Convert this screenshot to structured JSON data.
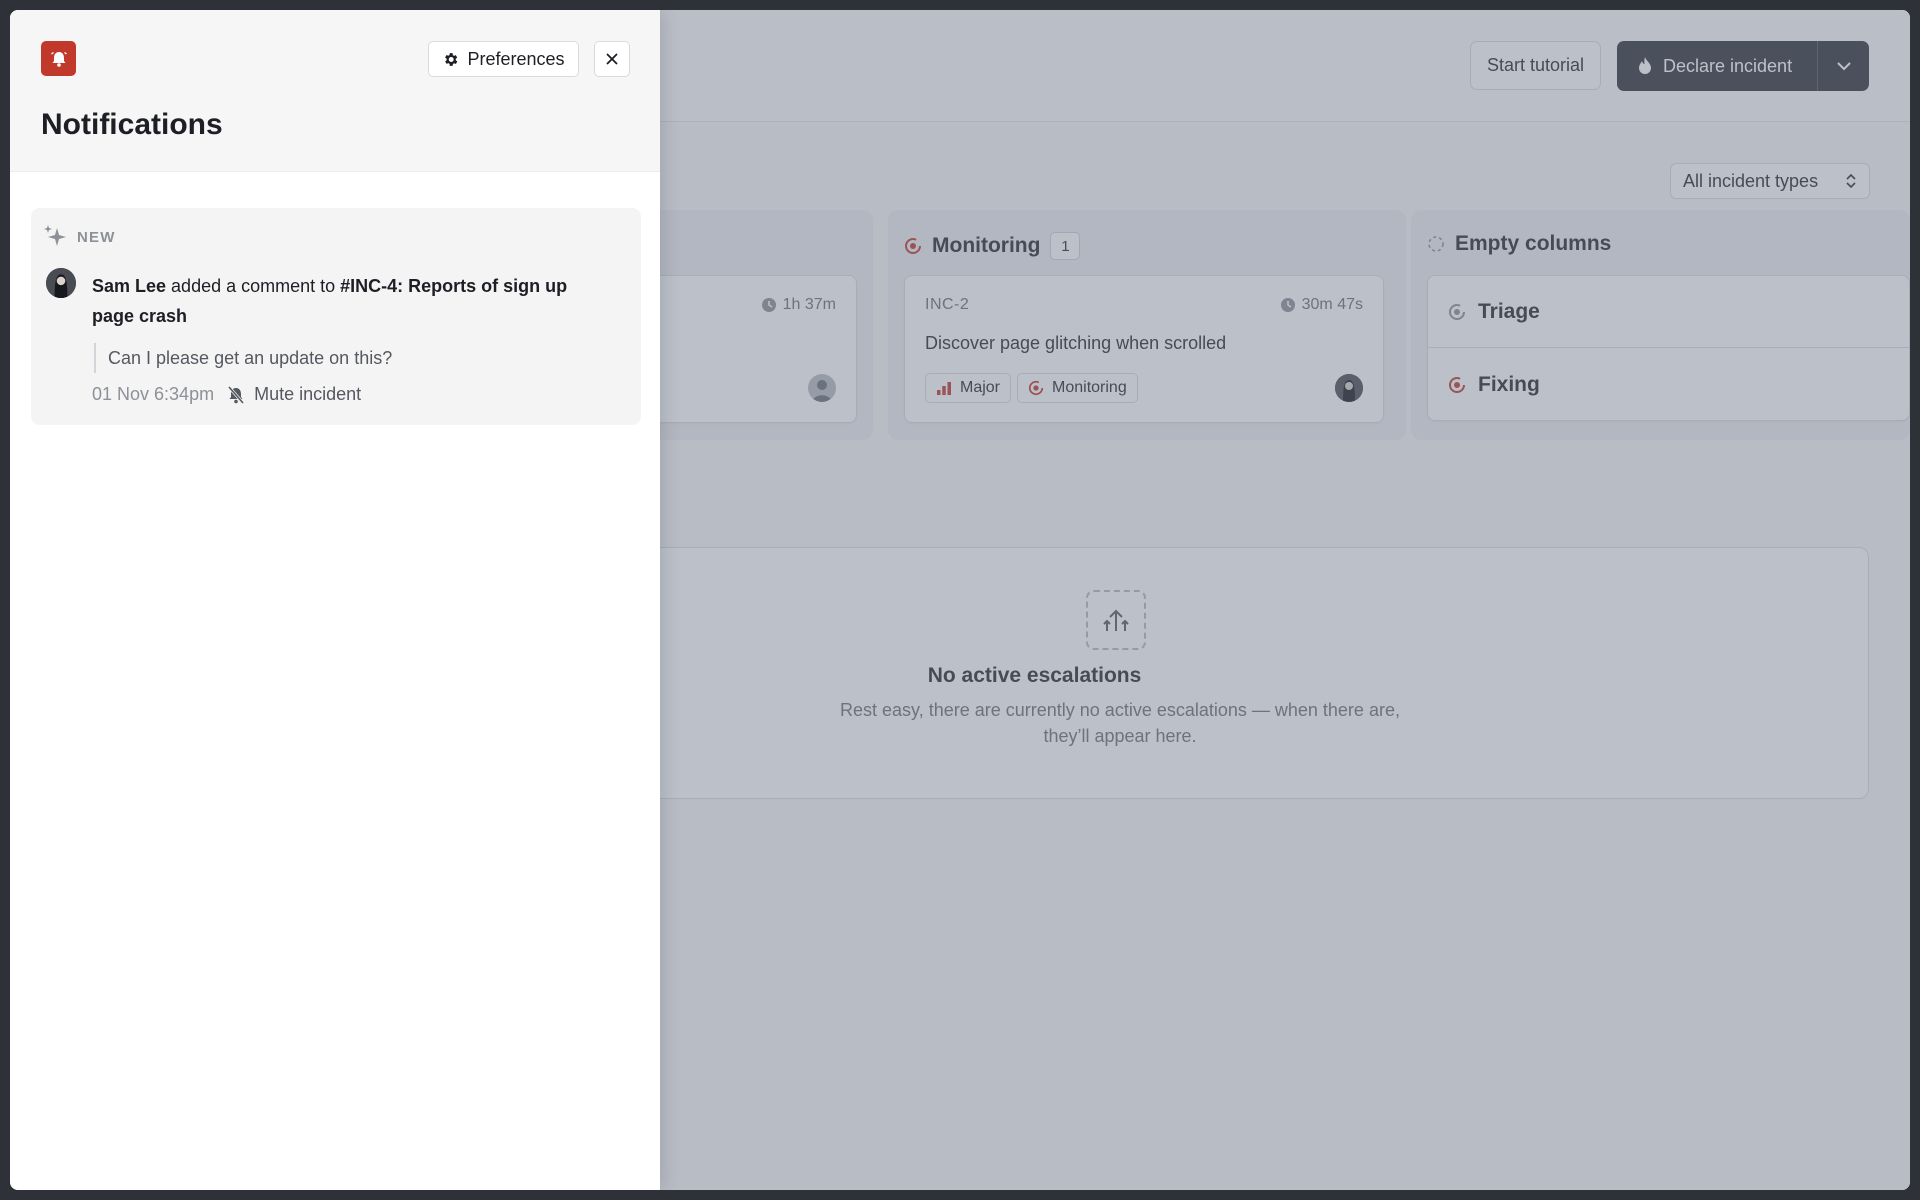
{
  "header": {
    "start_tutorial_label": "Start tutorial",
    "declare_incident_label": "Declare incident"
  },
  "filters": {
    "incident_types_label": "All incident types"
  },
  "columns": {
    "first": {
      "card": {
        "time": "1h 37m"
      }
    },
    "monitoring": {
      "title": "Monitoring",
      "count": "1",
      "card": {
        "ref": "INC-2",
        "time": "30m 47s",
        "title": "Discover page glitching when scrolled",
        "severity_label": "Major",
        "status_label": "Monitoring"
      }
    },
    "empty": {
      "title": "Empty columns",
      "items": [
        {
          "label": "Triage"
        },
        {
          "label": "Fixing"
        }
      ]
    }
  },
  "escalations": {
    "title": "No active escalations",
    "description": "Rest easy, there are currently no active escalations — when there are, they’ll appear here."
  },
  "drawer": {
    "title": "Notifications",
    "preferences_label": "Preferences",
    "notification": {
      "tag": "NEW",
      "actor": "Sam Lee",
      "action": " added a comment to ",
      "target": "#INC-4: Reports of sign up page crash",
      "quote": "Can I please get an update on this?",
      "timestamp": "01 Nov 6:34pm",
      "mute_label": "Mute incident"
    }
  },
  "colors": {
    "accent_red": "#c0392b",
    "dark_button": "#2e3038",
    "scrim": "#6e7688"
  }
}
